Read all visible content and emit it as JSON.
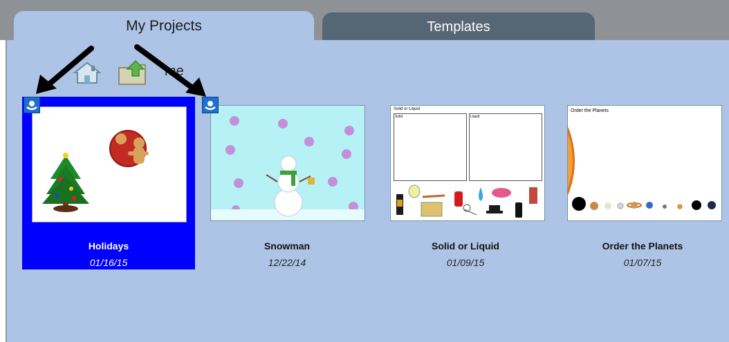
{
  "tabs": [
    {
      "label": "My Projects",
      "active": true
    },
    {
      "label": "Templates",
      "active": false
    }
  ],
  "toolbar": {
    "icons": [
      "home-icon",
      "upload-folder-icon"
    ],
    "partial_label": "me"
  },
  "projects": [
    {
      "title": "Holidays",
      "date": "01/16/15",
      "selected": true
    },
    {
      "title": "Snowman",
      "date": "12/22/14",
      "selected": false
    },
    {
      "title": "Solid or Liquid",
      "date": "01/09/15",
      "selected": false
    },
    {
      "title": "Order the Planets",
      "date": "01/07/15",
      "selected": false
    }
  ],
  "thumbnails": {
    "solid_liquid": {
      "heading": "Solid or Liquid",
      "box1": "Solid",
      "box2": "Liquid"
    },
    "planets": {
      "heading": "Order the Planets"
    }
  },
  "colors": {
    "panel": "#aec4e6",
    "active_tab": "#aec4e6",
    "inactive_tab": "#566674",
    "topbar": "#8e9297",
    "selected": "#0000ff",
    "badge": "#1f6fd0"
  }
}
